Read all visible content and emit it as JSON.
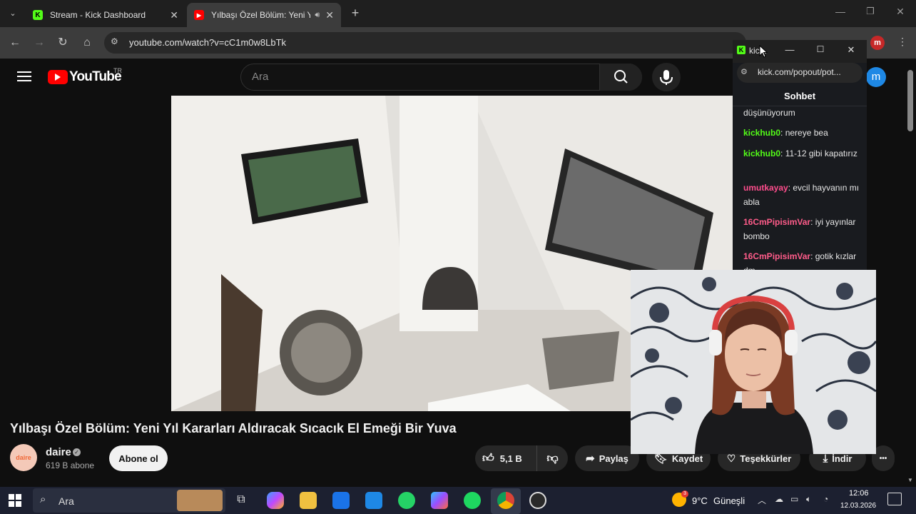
{
  "browser": {
    "tabs": [
      {
        "title": "Stream - Kick Dashboard",
        "favicon": "kick-icon"
      },
      {
        "title": "Yılbaşı Özel Bölüm: Yeni Yıl",
        "favicon": "youtube-icon",
        "active": true
      }
    ],
    "url": "youtube.com/watch?v=cC1m0w8LbTk",
    "profile_initial": "m"
  },
  "youtube": {
    "logo_text": "YouTube",
    "region": "TR",
    "search_placeholder": "Ara",
    "avatar_initial": "m",
    "video_title": "Yılbaşı Özel Bölüm: Yeni Yıl Kararları Aldıracak Sıcacık El Emeği Bir Yuva",
    "channel_name": "daire",
    "channel_logo_text": "daire",
    "subscribers": "619 B abone",
    "subscribe_label": "Abone ol",
    "likes": "5,1 B",
    "share_label": "Paylaş",
    "save_label": "Kaydet",
    "thanks_label": "Teşekkürler",
    "download_label": "İndir",
    "more_label": "•••"
  },
  "chat_popout": {
    "window_title": "kic...",
    "url": "kick.com/popout/pot...",
    "header": "Sohbet",
    "messages": [
      {
        "user": "",
        "text": "düşünüyorum",
        "color": "#e6e6e6"
      },
      {
        "user": "kickhub0",
        "text": "nereye bea",
        "color": "#53fc18"
      },
      {
        "user": "kickhub0",
        "text": "11-12 gibi kapatırız",
        "color": "#53fc18"
      },
      {
        "user": "umutkayay",
        "text": "evcil hayvanın mı abla",
        "color": "#ff4d8d"
      },
      {
        "user": "16CmPipisimVar",
        "text": "iyi yayınlar bombo",
        "color": "#ff5c8a"
      },
      {
        "user": "16CmPipisimVar",
        "text": "gotik kızlar dm",
        "color": "#ff5c8a"
      }
    ]
  },
  "taskbar": {
    "search_placeholder": "Ara",
    "weather_temp": "9°C",
    "weather_desc": "Güneşli",
    "weather_badge": "3",
    "time": "12:06",
    "date": "12.03.2026"
  },
  "colors": {
    "kick_green": "#53fc18",
    "youtube_red": "#ff0000",
    "avatar_blue": "#1e88e5",
    "profile_red": "#c62828"
  }
}
